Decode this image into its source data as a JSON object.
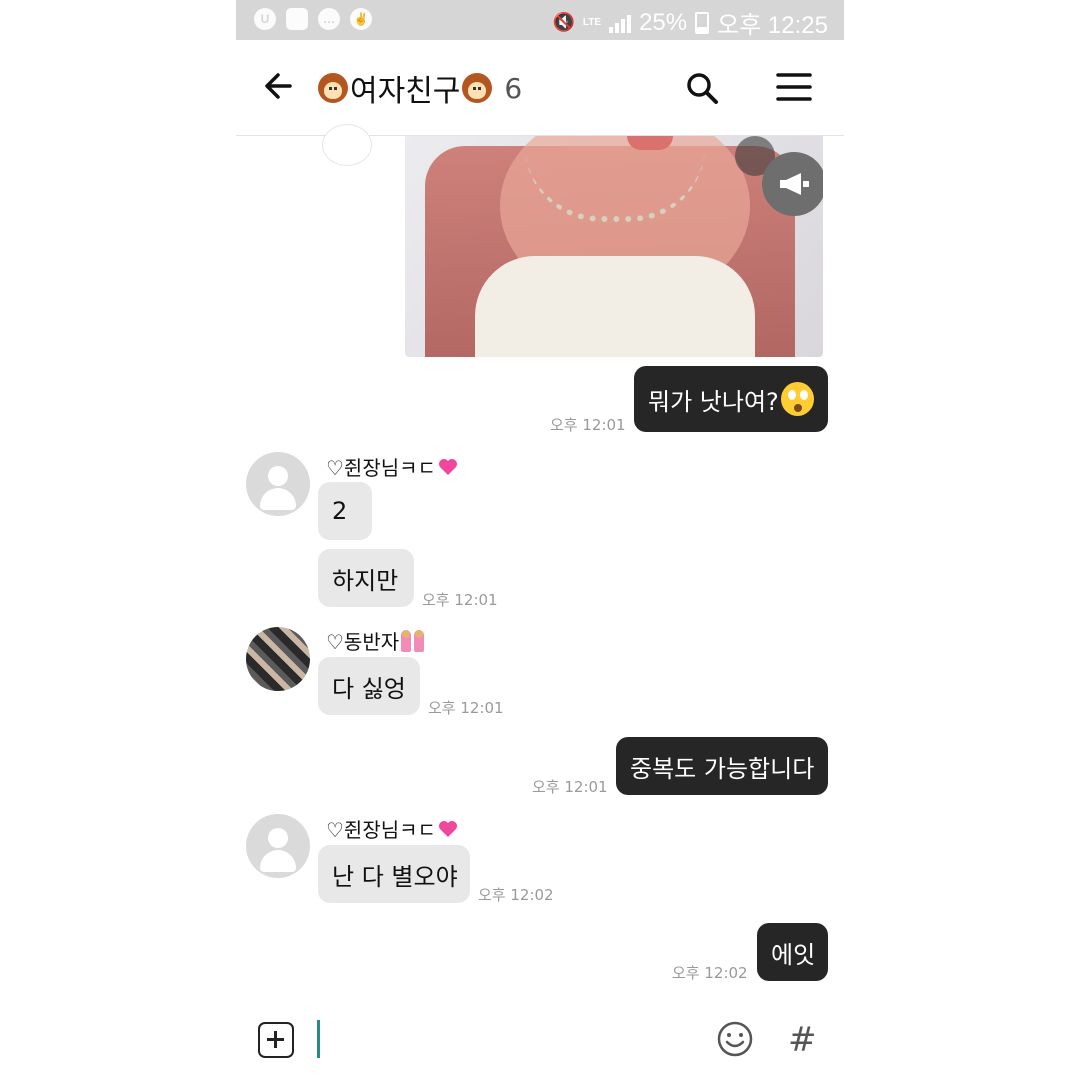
{
  "status_bar": {
    "icons": [
      "u-app-icon",
      "screenshot-icon",
      "talk-icon",
      "victory-hand-icon"
    ],
    "battery": "25%",
    "network": "LTE",
    "time": "오후 12:25"
  },
  "header": {
    "title": "여자친구",
    "member_count": "6",
    "title_emoji": "girl-face-emoji"
  },
  "messages": [
    {
      "type": "image",
      "direction": "out",
      "description_icon": "speaker-icon"
    },
    {
      "type": "text",
      "direction": "out",
      "text": "뭐가 낫나여?",
      "emoji": "surprised-face-emoji",
      "time": "오후 12:01"
    },
    {
      "type": "text",
      "direction": "in",
      "sender": "♡쥔장님ㅋㄷ",
      "sender_emoji": "sparkling-heart-emoji",
      "text": "2"
    },
    {
      "type": "text",
      "direction": "in",
      "text": "하지만",
      "time": "오후 12:01"
    },
    {
      "type": "text",
      "direction": "in",
      "sender": "♡동반자",
      "sender_emoji": "two-girls-emoji",
      "text": "다 싫엉",
      "time": "오후 12:01"
    },
    {
      "type": "text",
      "direction": "out",
      "text": "중복도 가능합니다",
      "time": "오후 12:01"
    },
    {
      "type": "text",
      "direction": "in",
      "sender": "♡쥔장님ㅋㄷ",
      "sender_emoji": "sparkling-heart-emoji",
      "text": "난 다 별오야",
      "time": "오후 12:02"
    },
    {
      "type": "text",
      "direction": "out",
      "text": "에잇",
      "time": "오후 12:02"
    }
  ],
  "input_bar": {
    "hash_symbol": "#"
  },
  "colors": {
    "status_bar_bg": "#d6d6d6",
    "outgoing_bubble": "#262626",
    "incoming_bubble": "#e8e8e8",
    "cursor": "#2a8a86"
  }
}
